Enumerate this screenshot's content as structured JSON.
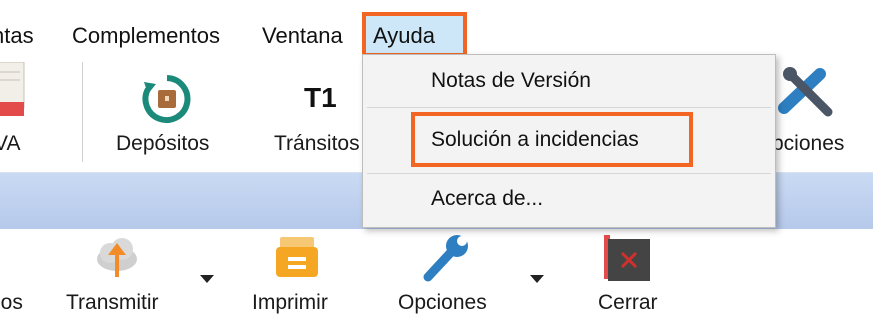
{
  "menubar": {
    "items": [
      "ntas",
      "Complementos",
      "Ventana"
    ],
    "active_item": "Ayuda"
  },
  "toolbar": {
    "items": [
      {
        "label": "VA",
        "icon": "document-icon"
      },
      {
        "label": "Depósitos",
        "icon": "deposit-refresh-icon"
      },
      {
        "label": "Tránsitos",
        "icon": "t1-text-icon",
        "icon_text": "T1"
      },
      {
        "label": "pciones",
        "icon": "tools-icon"
      }
    ]
  },
  "dropdown": {
    "items": [
      "Notas de Versión",
      "Solución a incidencias",
      "Acerca de..."
    ],
    "highlighted": "Solución a incidencias"
  },
  "toolbar2": {
    "items": [
      {
        "label": "ios"
      },
      {
        "label": "Transmitir",
        "icon": "upload-cloud-icon",
        "has_dropdown": true
      },
      {
        "label": "Imprimir",
        "icon": "printer-icon"
      },
      {
        "label": "Opciones",
        "icon": "wrench-icon",
        "has_dropdown": true
      },
      {
        "label": "Cerrar",
        "icon": "close-window-icon"
      }
    ]
  },
  "colors": {
    "highlight_border": "#f26522",
    "menu_selected_bg": "#cde6f8",
    "band": "#bcd0ee",
    "deposit_icon": "#1b8a7a",
    "transmit_arrow": "#f28c28",
    "printer": "#f5a623",
    "wrench": "#2e7fc1",
    "close_bg": "#444444",
    "close_x": "#d0312d"
  }
}
